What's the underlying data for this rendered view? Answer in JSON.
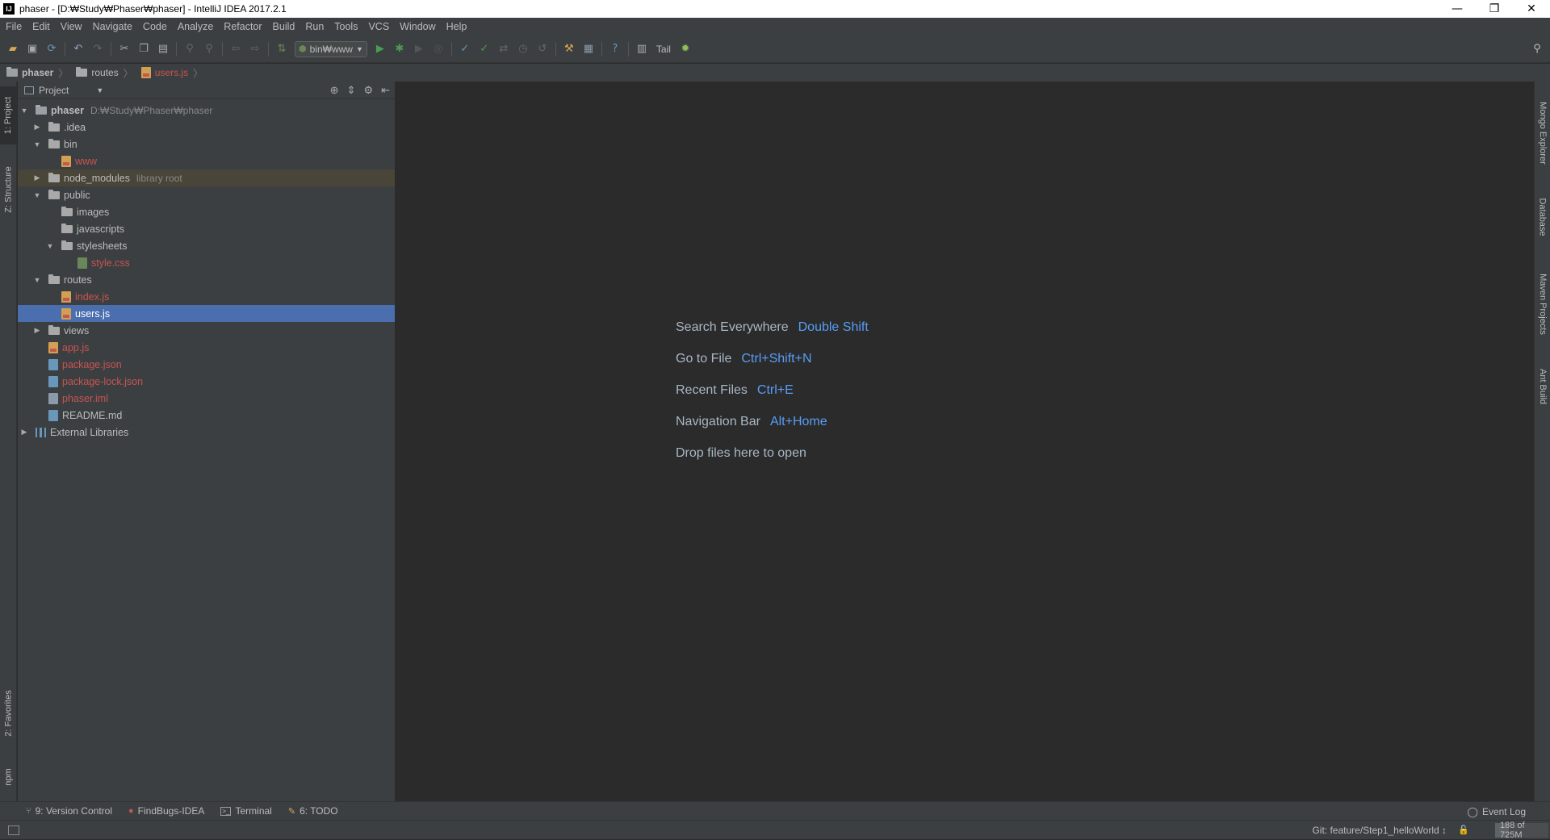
{
  "window": {
    "app_icon": "IJ",
    "title": "phaser - [D:₩Study₩Phaser₩phaser] - IntelliJ IDEA 2017.2.1",
    "minimize": "—",
    "restore": "❐",
    "close": "✕"
  },
  "menu": [
    "File",
    "Edit",
    "View",
    "Navigate",
    "Code",
    "Analyze",
    "Refactor",
    "Build",
    "Run",
    "Tools",
    "VCS",
    "Window",
    "Help"
  ],
  "toolbar": {
    "run_config": "bin₩www",
    "tail_label": "Tail"
  },
  "breadcrumb": {
    "project": "phaser",
    "folder": "routes",
    "file": "users.js"
  },
  "left_tool_tabs": {
    "project": "1: Project",
    "structure": "Z: Structure",
    "favorites": "2: Favorites",
    "npm": "npm"
  },
  "right_tool_tabs": {
    "mongo": "Mongo Explorer",
    "database": "Database",
    "maven": "Maven Projects",
    "ant": "Ant Build"
  },
  "project_panel": {
    "view_label": "Project",
    "tree": [
      {
        "label": "phaser",
        "hint": "D:₩Study₩Phaser₩phaser"
      },
      {
        "label": ".idea"
      },
      {
        "label": "bin"
      },
      {
        "label": "www"
      },
      {
        "label": "node_modules",
        "hint": "library root"
      },
      {
        "label": "public"
      },
      {
        "label": "images"
      },
      {
        "label": "javascripts"
      },
      {
        "label": "stylesheets"
      },
      {
        "label": "style.css"
      },
      {
        "label": "routes"
      },
      {
        "label": "index.js"
      },
      {
        "label": "users.js"
      },
      {
        "label": "views"
      },
      {
        "label": "app.js"
      },
      {
        "label": "package.json"
      },
      {
        "label": "package-lock.json"
      },
      {
        "label": "phaser.iml"
      },
      {
        "label": "README.md"
      },
      {
        "label": "External Libraries"
      }
    ]
  },
  "editor_hints": [
    {
      "label": "Search Everywhere",
      "key": "Double Shift"
    },
    {
      "label": "Go to File",
      "key": "Ctrl+Shift+N"
    },
    {
      "label": "Recent Files",
      "key": "Ctrl+E"
    },
    {
      "label": "Navigation Bar",
      "key": "Alt+Home"
    },
    {
      "label": "Drop files here to open",
      "key": ""
    }
  ],
  "bottom_tabs": {
    "version_control": "9: Version Control",
    "findbugs": "FindBugs-IDEA",
    "terminal": "Terminal",
    "todo": "6: TODO",
    "event_log": "Event Log"
  },
  "status": {
    "git_branch": "Git: feature/Step1_helloWorld ↕",
    "memory": "188 of 725M",
    "memory_used_fraction": 0.26
  }
}
